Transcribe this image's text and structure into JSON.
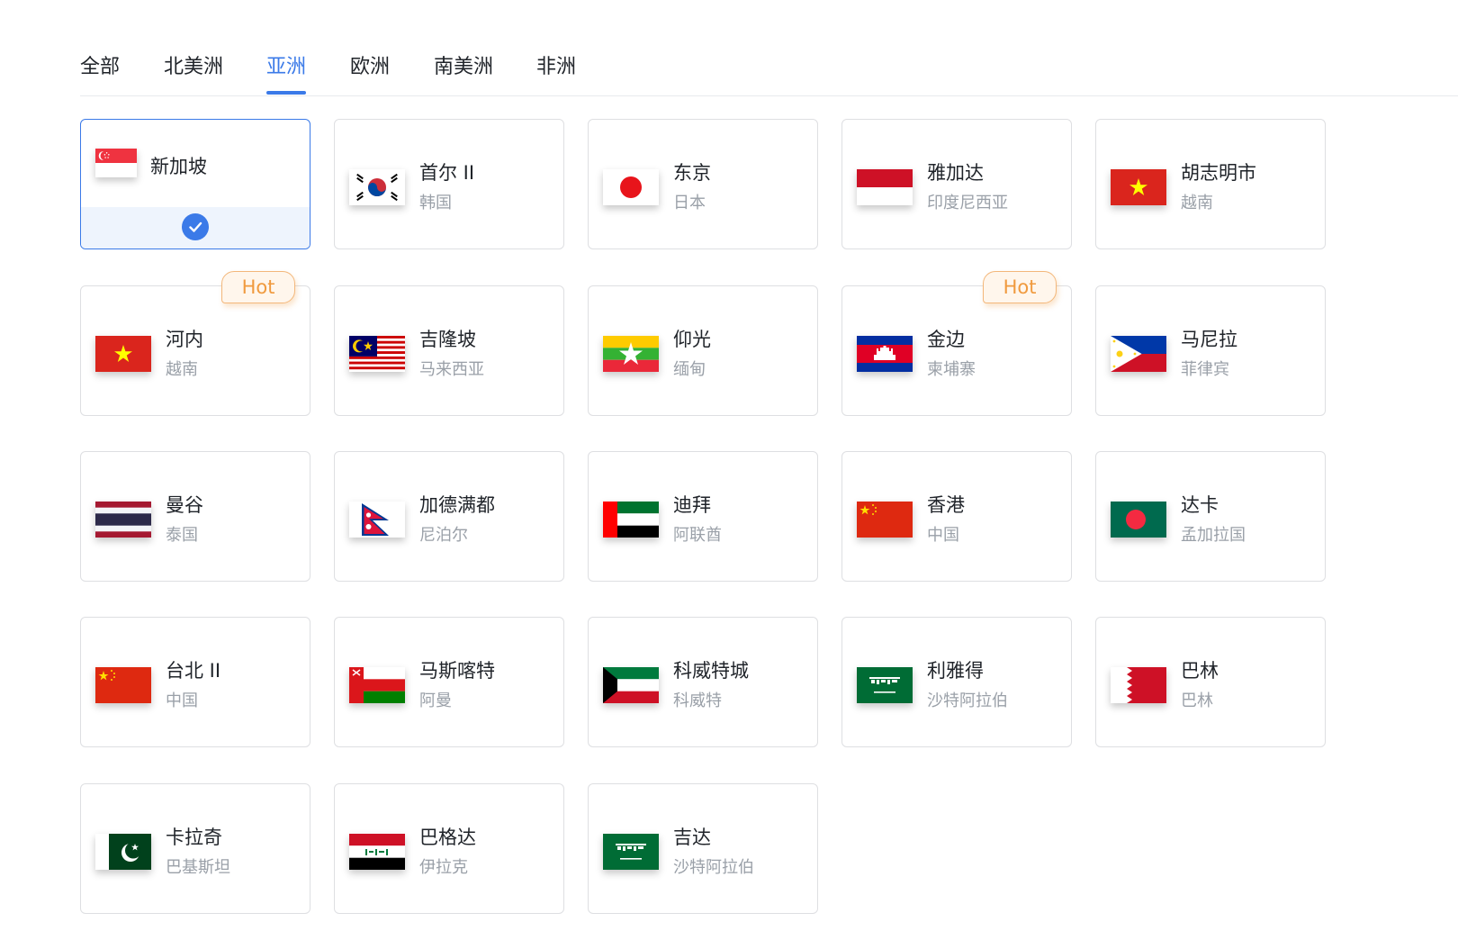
{
  "tabs": [
    {
      "label": "全部",
      "active": false
    },
    {
      "label": "北美洲",
      "active": false
    },
    {
      "label": "亚洲",
      "active": true
    },
    {
      "label": "欧洲",
      "active": false
    },
    {
      "label": "南美洲",
      "active": false
    },
    {
      "label": "非洲",
      "active": false
    }
  ],
  "hot_label": "Hot",
  "colors": {
    "accent": "#3b7ae8",
    "hot": "#f09a3e",
    "muted_text": "#9aa0a8"
  },
  "locations": [
    {
      "city": "新加坡",
      "country": "",
      "flag": "sg-flag-icon",
      "selected": true,
      "hot": false
    },
    {
      "city": "首尔 II",
      "country": "韩国",
      "flag": "kr-flag-icon",
      "selected": false,
      "hot": false
    },
    {
      "city": "东京",
      "country": "日本",
      "flag": "jp-flag-icon",
      "selected": false,
      "hot": false
    },
    {
      "city": "雅加达",
      "country": "印度尼西亚",
      "flag": "id-flag-icon",
      "selected": false,
      "hot": false
    },
    {
      "city": "胡志明市",
      "country": "越南",
      "flag": "vn-flag-icon",
      "selected": false,
      "hot": false
    },
    {
      "city": "河内",
      "country": "越南",
      "flag": "vn-flag-icon",
      "selected": false,
      "hot": true
    },
    {
      "city": "吉隆坡",
      "country": "马来西亚",
      "flag": "my-flag-icon",
      "selected": false,
      "hot": false
    },
    {
      "city": "仰光",
      "country": "缅甸",
      "flag": "mm-flag-icon",
      "selected": false,
      "hot": false
    },
    {
      "city": "金边",
      "country": "柬埔寨",
      "flag": "kh-flag-icon",
      "selected": false,
      "hot": true
    },
    {
      "city": "马尼拉",
      "country": "菲律宾",
      "flag": "ph-flag-icon",
      "selected": false,
      "hot": false
    },
    {
      "city": "曼谷",
      "country": "泰国",
      "flag": "th-flag-icon",
      "selected": false,
      "hot": false
    },
    {
      "city": "加德满都",
      "country": "尼泊尔",
      "flag": "np-flag-icon",
      "selected": false,
      "hot": false
    },
    {
      "city": "迪拜",
      "country": "阿联酋",
      "flag": "ae-flag-icon",
      "selected": false,
      "hot": false
    },
    {
      "city": "香港",
      "country": "中国",
      "flag": "cn-flag-icon",
      "selected": false,
      "hot": false
    },
    {
      "city": "达卡",
      "country": "孟加拉国",
      "flag": "bd-flag-icon",
      "selected": false,
      "hot": false
    },
    {
      "city": "台北 II",
      "country": "中国",
      "flag": "cn-flag-icon",
      "selected": false,
      "hot": false
    },
    {
      "city": "马斯喀特",
      "country": "阿曼",
      "flag": "om-flag-icon",
      "selected": false,
      "hot": false
    },
    {
      "city": "科威特城",
      "country": "科威特",
      "flag": "kw-flag-icon",
      "selected": false,
      "hot": false
    },
    {
      "city": "利雅得",
      "country": "沙特阿拉伯",
      "flag": "sa-flag-icon",
      "selected": false,
      "hot": false
    },
    {
      "city": "巴林",
      "country": "巴林",
      "flag": "bh-flag-icon",
      "selected": false,
      "hot": false
    },
    {
      "city": "卡拉奇",
      "country": "巴基斯坦",
      "flag": "pk-flag-icon",
      "selected": false,
      "hot": false
    },
    {
      "city": "巴格达",
      "country": "伊拉克",
      "flag": "iq-flag-icon",
      "selected": false,
      "hot": false
    },
    {
      "city": "吉达",
      "country": "沙特阿拉伯",
      "flag": "sa-flag-icon",
      "selected": false,
      "hot": false
    }
  ]
}
